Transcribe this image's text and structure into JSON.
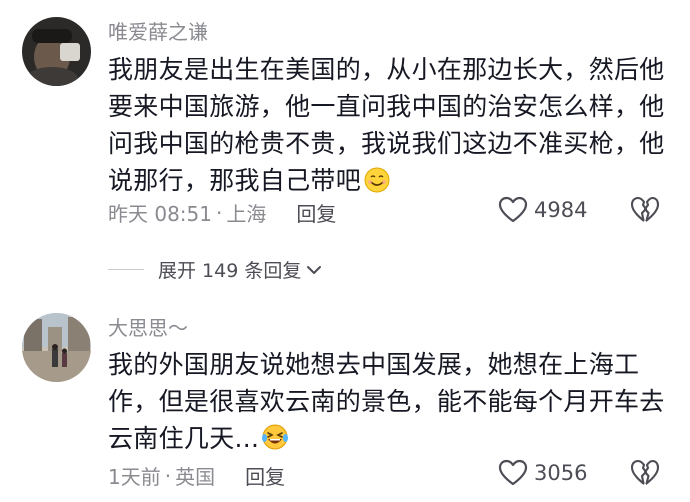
{
  "comments": [
    {
      "username": "唯爱薛之谦",
      "text": "我朋友是出生在美国的，从小在那边长大，然后他要来中国旅游，他一直问我中国的治安怎么样，他问我中国的枪贵不贵，我说我们这边不准买枪，他说那行，那我自己带吧",
      "emoji": "smiling-face-emoji",
      "time": "昨天 08:51",
      "location": "上海",
      "reply_label": "回复",
      "likes": "4984"
    },
    {
      "username": "大思思～",
      "text": "我的外国朋友说她想去中国发展，她想在上海工作，但是很喜欢云南的景色，能不能每个月开车去云南住几天...",
      "emoji": "laughing-tears-emoji",
      "time": "1天前",
      "location": "英国",
      "reply_label": "回复",
      "likes": "3056"
    }
  ],
  "expand_replies": {
    "label": "展开 149 条回复"
  },
  "colors": {
    "primary_text": "#161823",
    "secondary_text": "#8a8b91",
    "action_text": "#4c4d55"
  },
  "separator": "·"
}
